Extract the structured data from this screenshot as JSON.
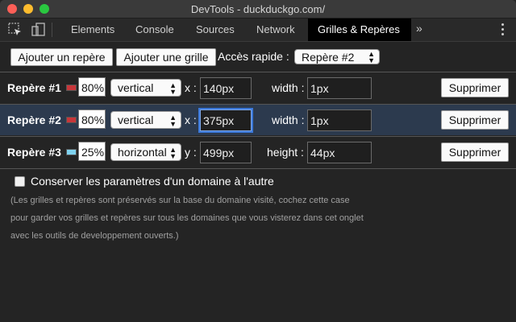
{
  "window": {
    "title": "DevTools - duckduckgo.com/"
  },
  "tabs": [
    {
      "label": "Elements"
    },
    {
      "label": "Console"
    },
    {
      "label": "Sources"
    },
    {
      "label": "Network"
    },
    {
      "label": "Grilles & Repères",
      "active": true
    }
  ],
  "tabbar": {
    "more_label": "»"
  },
  "toolbar": {
    "add_guide": "Ajouter un repère",
    "add_grid": "Ajouter une grille",
    "quick_access_label": "Accès rapide :",
    "quick_access_value": "Repère #2"
  },
  "guides": [
    {
      "name": "Repère #1",
      "color": "#c8363a",
      "opacity": "80%",
      "orientation": "vertical",
      "axis": "x :",
      "position": "140px",
      "size_label": "width :",
      "size": "1px",
      "delete": "Supprimer",
      "selected": false
    },
    {
      "name": "Repère #2",
      "color": "#c8363a",
      "opacity": "80%",
      "orientation": "vertical",
      "axis": "x :",
      "position": "375px",
      "size_label": "width :",
      "size": "1px",
      "delete": "Supprimer",
      "selected": true
    },
    {
      "name": "Repère #3",
      "color": "#7fd3f0",
      "opacity": "25%",
      "orientation": "horizontal",
      "axis": "y :",
      "position": "499px",
      "size_label": "height :",
      "size": "44px",
      "delete": "Supprimer",
      "selected": false
    }
  ],
  "settings": {
    "keep_settings_label": "Conserver les paramètres d'un domaine à l'autre",
    "keep_settings_checked": false,
    "note": "(Les grilles et repères sont préservés sur la base du domaine visité, cochez cette case pour garder vos grilles et repères sur tous les domaines que vous visterez dans cet onglet avec les outils de developpement ouverts.)"
  }
}
